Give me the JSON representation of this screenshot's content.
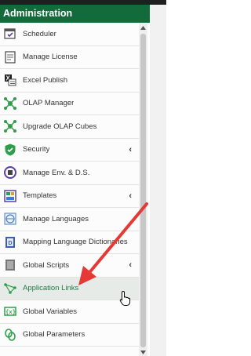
{
  "header": {
    "title": "Administration"
  },
  "sidebar": {
    "items": [
      {
        "label": "Scheduler",
        "icon": "calendar-check-icon"
      },
      {
        "label": "Manage License",
        "icon": "license-doc-icon"
      },
      {
        "label": "Excel Publish",
        "icon": "excel-icon"
      },
      {
        "label": "OLAP Manager",
        "icon": "olap-network-icon"
      },
      {
        "label": "Upgrade OLAP Cubes",
        "icon": "olap-upgrade-icon"
      },
      {
        "label": "Security",
        "icon": "shield-check-icon",
        "has_submenu": true
      },
      {
        "label": "Manage Env. & D.S.",
        "icon": "env-cycle-icon"
      },
      {
        "label": "Templates",
        "icon": "template-icon",
        "has_submenu": true
      },
      {
        "label": "Manage Languages",
        "icon": "globe-icon"
      },
      {
        "label": "Mapping Language Dictionaries",
        "icon": "dictionary-icon"
      },
      {
        "label": "Global Scripts",
        "icon": "script-icon",
        "has_submenu": true
      },
      {
        "label": "Application Links",
        "icon": "links-icon",
        "active": true
      },
      {
        "label": "Global Variables",
        "icon": "variables-icon"
      },
      {
        "label": "Global Parameters",
        "icon": "parameters-icon"
      }
    ],
    "submenu_chevron": "‹"
  },
  "colors": {
    "header_bg": "#136b3b",
    "active_text": "#1e7a45",
    "annotation_arrow": "#e53935"
  },
  "icons": {
    "chevron": "chevron-left-icon",
    "cursor": "hand-pointer-icon",
    "arrow": "annotation-arrow"
  }
}
